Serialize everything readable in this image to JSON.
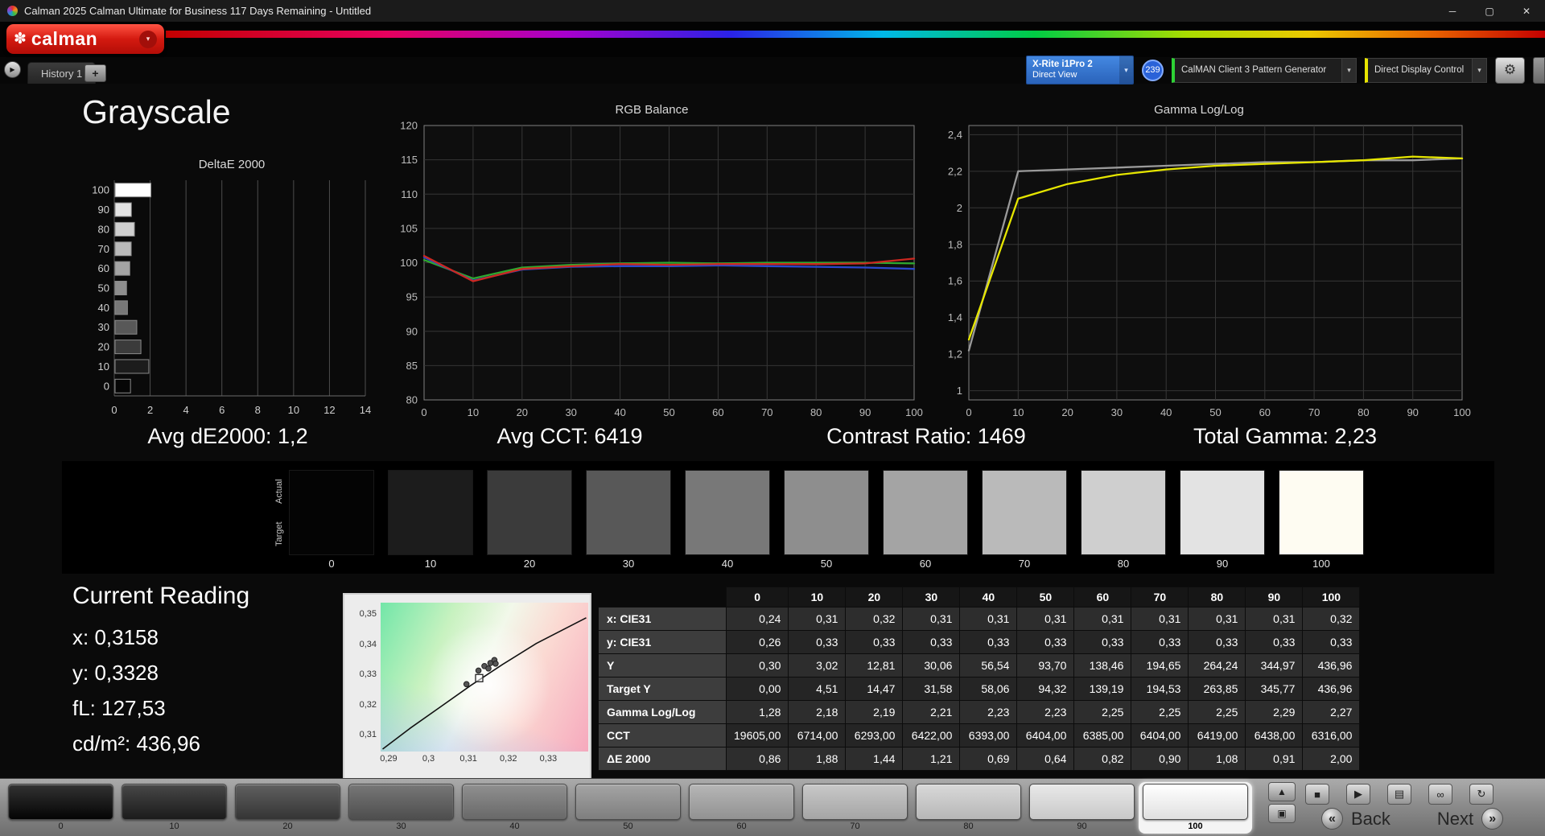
{
  "window": {
    "title": "Calman 2025 Calman Ultimate for Business 117 Days Remaining  - Untitled"
  },
  "icons": {
    "flower": "✽",
    "caret": "▾",
    "tab_arrow": "▶",
    "add_tab": "+",
    "gear": "⚙",
    "minimize": "─",
    "maximize": "▢",
    "close": "✕",
    "stop": "■",
    "play": "▶",
    "save": "▤",
    "link": "∞",
    "refresh": "↻",
    "collapse": "▲",
    "layers": "▣",
    "back_chev": "«",
    "next_chev": "»"
  },
  "toolbar": {
    "logo_text": "calman",
    "meter": {
      "line1": "X-Rite i1Pro 2",
      "line2": "Direct View"
    },
    "badge": "239",
    "pattern_gen": "CalMAN Client 3 Pattern Generator",
    "display_ctrl": "Direct Display Control"
  },
  "accent_colors": {
    "logo_red": "#d41a10",
    "meter_blue": "#2a63ba",
    "pattern_green": "#2ed235",
    "display_yellow": "#e8e400"
  },
  "tabs": {
    "active": "History 1"
  },
  "page_title": "Grayscale",
  "stats": [
    "Avg dE2000: 1,2",
    "Avg CCT: 6419",
    "Contrast Ratio: 1469",
    "Total Gamma: 2,23"
  ],
  "chart_data": [
    {
      "type": "bar",
      "title": "DeltaE 2000",
      "orientation": "horizontal",
      "categories": [
        100,
        90,
        80,
        70,
        60,
        50,
        40,
        30,
        20,
        10,
        0
      ],
      "values": [
        2.0,
        0.91,
        1.08,
        0.9,
        0.82,
        0.64,
        0.69,
        1.21,
        1.44,
        1.88,
        0.86
      ],
      "bar_colors": [
        "#ffffff",
        "#e3e3e3",
        "#cfcfcf",
        "#bababa",
        "#a4a4a4",
        "#8e8e8e",
        "#787878",
        "#585858",
        "#3b3b3b",
        "#1c1c1c",
        "#060606"
      ],
      "xlim": [
        0,
        14
      ],
      "xticks": [
        0,
        2,
        4,
        6,
        8,
        10,
        12,
        14
      ],
      "grid": "vertical"
    },
    {
      "type": "line",
      "title": "RGB Balance",
      "x": [
        0,
        10,
        20,
        30,
        40,
        50,
        60,
        70,
        80,
        90,
        100
      ],
      "series": [
        {
          "name": "Green",
          "color": "#2fa82f",
          "values": [
            100.4,
            97.7,
            99.3,
            99.7,
            99.9,
            100.0,
            99.9,
            100.0,
            100.0,
            100.0,
            99.9
          ]
        },
        {
          "name": "Blue",
          "color": "#2a48cc",
          "values": [
            100.8,
            97.4,
            99.0,
            99.4,
            99.5,
            99.5,
            99.6,
            99.5,
            99.4,
            99.3,
            99.1
          ]
        },
        {
          "name": "Red",
          "color": "#cc2820",
          "values": [
            101.0,
            97.3,
            99.1,
            99.5,
            99.8,
            99.7,
            99.8,
            99.8,
            99.8,
            99.9,
            100.6
          ]
        }
      ],
      "xlim": [
        0,
        100
      ],
      "ylim": [
        80,
        120
      ],
      "xticks": [
        0,
        10,
        20,
        30,
        40,
        50,
        60,
        70,
        80,
        90,
        100
      ],
      "yticks": [
        80,
        85,
        90,
        95,
        100,
        105,
        110,
        115,
        120
      ],
      "grid": "both"
    },
    {
      "type": "line",
      "title": "Gamma Log/Log",
      "x": [
        0,
        10,
        20,
        30,
        40,
        50,
        60,
        70,
        80,
        90,
        100
      ],
      "series": [
        {
          "name": "Target",
          "color": "#9a9a9a",
          "values": [
            1.22,
            2.2,
            2.21,
            2.22,
            2.23,
            2.24,
            2.25,
            2.25,
            2.26,
            2.26,
            2.27
          ]
        },
        {
          "name": "Measured",
          "color": "#e6e600",
          "values": [
            1.28,
            2.05,
            2.13,
            2.18,
            2.21,
            2.23,
            2.24,
            2.25,
            2.26,
            2.28,
            2.27
          ]
        }
      ],
      "xlim": [
        0,
        100
      ],
      "ylim": [
        0.95,
        2.45
      ],
      "xticks": [
        0,
        10,
        20,
        30,
        40,
        50,
        60,
        70,
        80,
        90,
        100
      ],
      "yticks": [
        {
          "v": 1,
          "label": "1"
        },
        {
          "v": 1.2,
          "label": "1,2"
        },
        {
          "v": 1.4,
          "label": "1,4"
        },
        {
          "v": 1.6,
          "label": "1,6"
        },
        {
          "v": 1.8,
          "label": "1,8"
        },
        {
          "v": 2,
          "label": "2"
        },
        {
          "v": 2.2,
          "label": "2,2"
        },
        {
          "v": 2.4,
          "label": "2,4"
        }
      ],
      "grid": "both"
    },
    {
      "type": "scatter",
      "title": "CIE 1931 xy chromaticity (detail)",
      "xlim": [
        0.288,
        0.34
      ],
      "ylim": [
        0.3047,
        0.354
      ],
      "xticks": [
        {
          "v": 0.29,
          "label": "0,29"
        },
        {
          "v": 0.3,
          "label": "0,3"
        },
        {
          "v": 0.31,
          "label": "0,31"
        },
        {
          "v": 0.32,
          "label": "0,32"
        },
        {
          "v": 0.33,
          "label": "0,33"
        }
      ],
      "yticks": [
        {
          "v": 0.31,
          "label": "0,31"
        },
        {
          "v": 0.32,
          "label": "0,32"
        },
        {
          "v": 0.33,
          "label": "0,33"
        },
        {
          "v": 0.34,
          "label": "0,34"
        },
        {
          "v": 0.35,
          "label": "0,35"
        }
      ],
      "locus": [
        [
          0.2885,
          0.3055
        ],
        [
          0.2955,
          0.3125
        ],
        [
          0.303,
          0.3195
        ],
        [
          0.3105,
          0.3265
        ],
        [
          0.3185,
          0.3335
        ],
        [
          0.327,
          0.3405
        ],
        [
          0.3395,
          0.349
        ]
      ],
      "points": [
        [
          0.3125,
          0.3315
        ],
        [
          0.314,
          0.333
        ],
        [
          0.3155,
          0.334
        ],
        [
          0.3165,
          0.335
        ],
        [
          0.315,
          0.3322
        ],
        [
          0.3168,
          0.3338
        ],
        [
          0.3095,
          0.327
        ]
      ],
      "target": [
        0.3127,
        0.329
      ]
    }
  ],
  "swatches": {
    "actual_label": "Actual",
    "target_label": "Target",
    "items": [
      {
        "label": "0",
        "color": "#040404"
      },
      {
        "label": "10",
        "color": "#1c1c1c"
      },
      {
        "label": "20",
        "color": "#3b3b3b"
      },
      {
        "label": "30",
        "color": "#585858"
      },
      {
        "label": "40",
        "color": "#787878"
      },
      {
        "label": "50",
        "color": "#8e8e8e"
      },
      {
        "label": "60",
        "color": "#a4a4a4"
      },
      {
        "label": "70",
        "color": "#bababa"
      },
      {
        "label": "80",
        "color": "#cfcfcf"
      },
      {
        "label": "90",
        "color": "#e3e3e3"
      },
      {
        "label": "100",
        "color": "#fefcf2"
      }
    ]
  },
  "current_reading": {
    "title": "Current Reading",
    "lines": [
      "x: 0,3158",
      "y: 0,3328",
      "fL: 127,53",
      "cd/m²: 436,96"
    ]
  },
  "table": {
    "columns": [
      "0",
      "10",
      "20",
      "30",
      "40",
      "50",
      "60",
      "70",
      "80",
      "90",
      "100"
    ],
    "rows": [
      {
        "label": "x: CIE31",
        "values": [
          "0,24",
          "0,31",
          "0,32",
          "0,31",
          "0,31",
          "0,31",
          "0,31",
          "0,31",
          "0,31",
          "0,31",
          "0,32"
        ]
      },
      {
        "label": "y: CIE31",
        "values": [
          "0,26",
          "0,33",
          "0,33",
          "0,33",
          "0,33",
          "0,33",
          "0,33",
          "0,33",
          "0,33",
          "0,33",
          "0,33"
        ]
      },
      {
        "label": "Y",
        "values": [
          "0,30",
          "3,02",
          "12,81",
          "30,06",
          "56,54",
          "93,70",
          "138,46",
          "194,65",
          "264,24",
          "344,97",
          "436,96"
        ]
      },
      {
        "label": "Target Y",
        "values": [
          "0,00",
          "4,51",
          "14,47",
          "31,58",
          "58,06",
          "94,32",
          "139,19",
          "194,53",
          "263,85",
          "345,77",
          "436,96"
        ]
      },
      {
        "label": "Gamma Log/Log",
        "values": [
          "1,28",
          "2,18",
          "2,19",
          "2,21",
          "2,23",
          "2,23",
          "2,25",
          "2,25",
          "2,25",
          "2,29",
          "2,27"
        ]
      },
      {
        "label": "CCT",
        "values": [
          "19605,00",
          "6714,00",
          "6293,00",
          "6422,00",
          "6393,00",
          "6404,00",
          "6385,00",
          "6404,00",
          "6419,00",
          "6438,00",
          "6316,00"
        ]
      },
      {
        "label": "ΔE 2000",
        "values": [
          "0,86",
          "1,88",
          "1,44",
          "1,21",
          "0,69",
          "0,64",
          "0,82",
          "0,90",
          "1,08",
          "0,91",
          "2,00"
        ]
      }
    ]
  },
  "bottom_bar": {
    "back_label": "Back",
    "next_label": "Next",
    "patterns": [
      {
        "label": "0",
        "color": "#050505",
        "selected": false
      },
      {
        "label": "10",
        "color": "#1f1f1f",
        "selected": false
      },
      {
        "label": "20",
        "color": "#3c3c3c",
        "selected": false
      },
      {
        "label": "30",
        "color": "#595959",
        "selected": false
      },
      {
        "label": "40",
        "color": "#777777",
        "selected": false
      },
      {
        "label": "50",
        "color": "#909090",
        "selected": false
      },
      {
        "label": "60",
        "color": "#a6a6a6",
        "selected": false
      },
      {
        "label": "70",
        "color": "#bcbcbc",
        "selected": false
      },
      {
        "label": "80",
        "color": "#d0d0d0",
        "selected": false
      },
      {
        "label": "90",
        "color": "#e4e4e4",
        "selected": false
      },
      {
        "label": "100",
        "color": "#ffffff",
        "selected": true
      }
    ]
  }
}
